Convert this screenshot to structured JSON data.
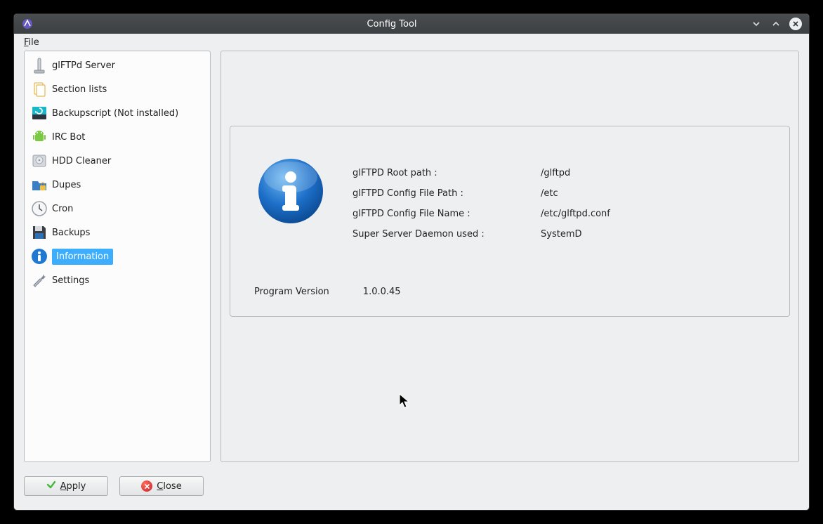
{
  "window": {
    "title": "Config Tool"
  },
  "menu": {
    "file": "File"
  },
  "sidebar": {
    "items": [
      {
        "label": "glFTPd Server"
      },
      {
        "label": "Section lists"
      },
      {
        "label": "Backupscript (Not installed)"
      },
      {
        "label": "IRC Bot"
      },
      {
        "label": "HDD Cleaner"
      },
      {
        "label": "Dupes"
      },
      {
        "label": "Cron"
      },
      {
        "label": "Backups"
      },
      {
        "label": "Information"
      },
      {
        "label": "Settings"
      }
    ]
  },
  "info": {
    "labels": {
      "root_path": "glFTPD Root path :",
      "config_path": "glFTPD Config File Path :",
      "config_name": "glFTPD Config File Name :",
      "daemon": "Super Server Daemon used :"
    },
    "values": {
      "root_path": "/glftpd",
      "config_path": "/etc",
      "config_name": "/etc/glftpd.conf",
      "daemon": "SystemD"
    },
    "program_version_label": "Program Version",
    "program_version_value": "1.0.0.45"
  },
  "buttons": {
    "apply": "Apply",
    "close": "Close"
  }
}
